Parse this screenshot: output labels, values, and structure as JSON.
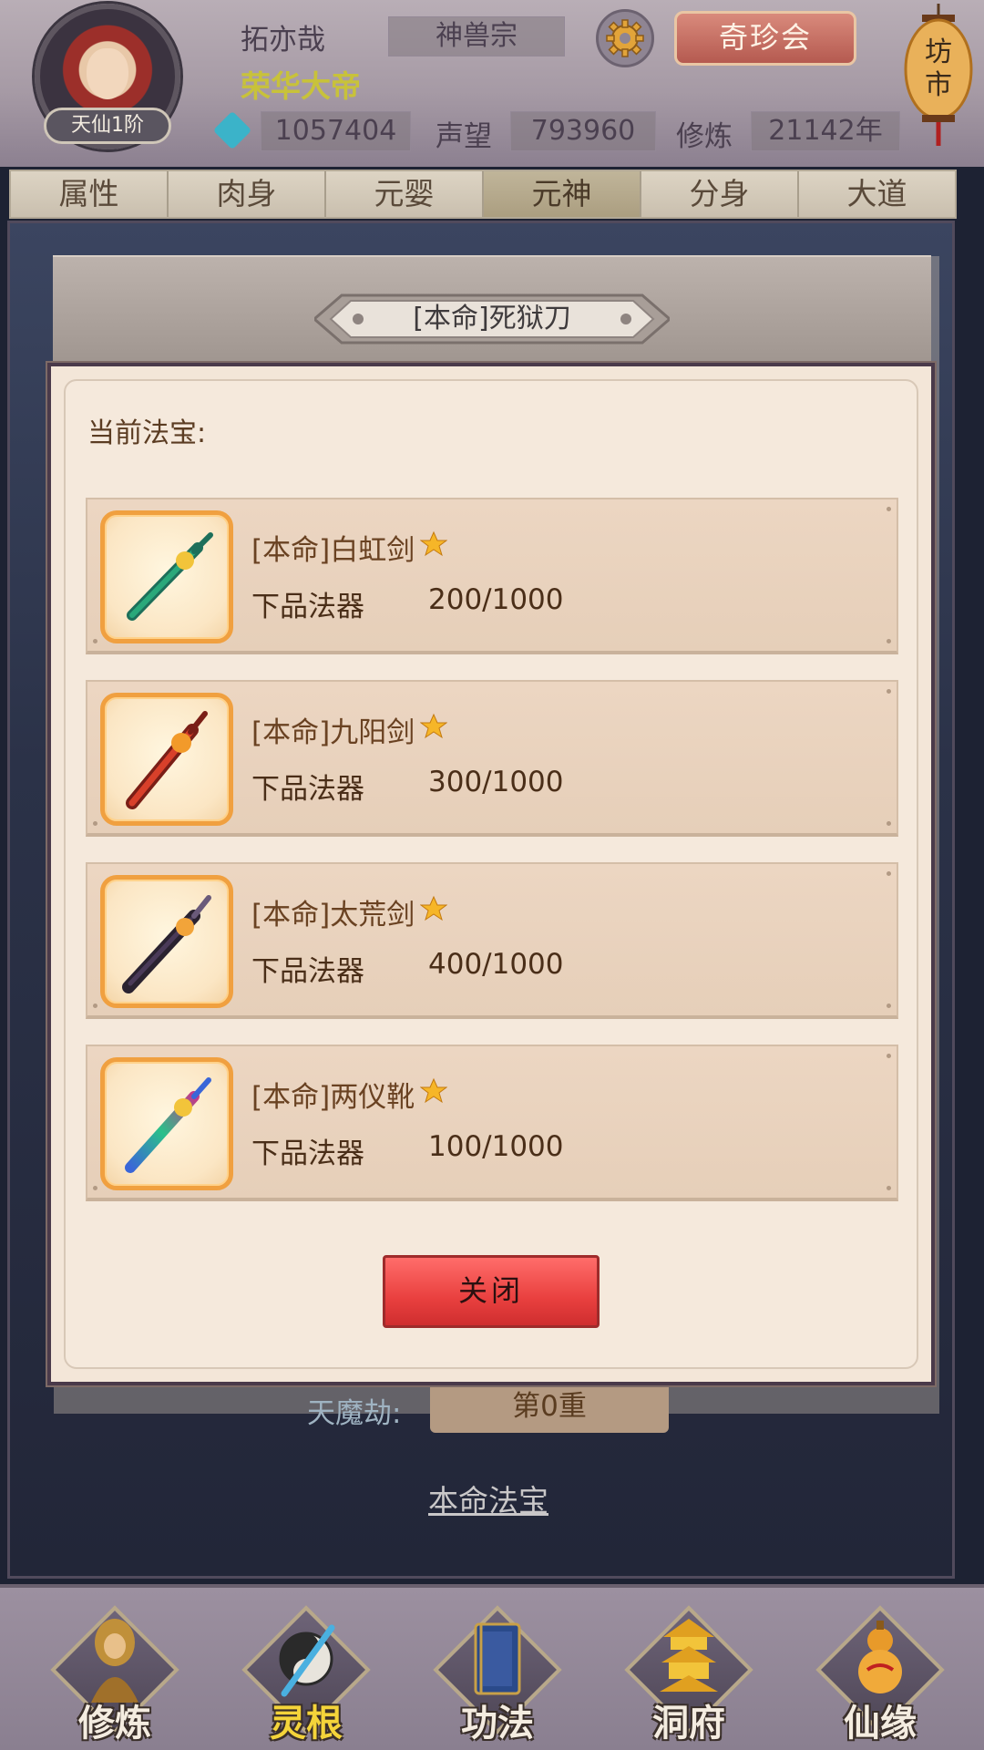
{
  "player": {
    "name": "拓亦哉",
    "title": "荣华大帝",
    "rank": "天仙1阶",
    "sect": "神兽宗",
    "spirit_stones": "1057404",
    "prestige_label": "声望",
    "prestige": "793960",
    "cultivation_label": "修炼",
    "cultivation": "21142年"
  },
  "header": {
    "treasure_button": "奇珍会",
    "market_label": "坊市"
  },
  "tabs": [
    {
      "label": "属性"
    },
    {
      "label": "肉身"
    },
    {
      "label": "元婴"
    },
    {
      "label": "元神"
    },
    {
      "label": "分身"
    },
    {
      "label": "大道"
    }
  ],
  "active_tab": "元神",
  "modal": {
    "title": "[本命]死狱刀",
    "current_label": "当前法宝:",
    "items": [
      {
        "name": "[本命]白虹剑",
        "grade": "下品法器",
        "progress": "200/1000",
        "blade_color": "#2aa87a",
        "hilt_color": "#1d6f5a"
      },
      {
        "name": "[本命]九阳剑",
        "grade": "下品法器",
        "progress": "300/1000",
        "blade_color": "#d8402a",
        "hilt_color": "#7a1e16"
      },
      {
        "name": "[本命]太荒剑",
        "grade": "下品法器",
        "progress": "400/1000",
        "blade_color": "#2a2230",
        "hilt_color": "#6a5a7a"
      },
      {
        "name": "[本命]两仪靴",
        "grade": "下品法器",
        "progress": "100/1000",
        "blade_color": "#3a66d8",
        "hilt_color": "#c23a8a"
      }
    ],
    "close_button": "关闭"
  },
  "background": {
    "tianmojie_label": "天魔劫:",
    "tianmojie_value": "第0重",
    "benming_link": "本命法宝"
  },
  "bottom_nav": [
    {
      "label": "修炼",
      "icon": "monk-icon"
    },
    {
      "label": "灵根",
      "icon": "sword-yinyang-icon",
      "active": true
    },
    {
      "label": "功法",
      "icon": "book-icon"
    },
    {
      "label": "洞府",
      "icon": "pagoda-icon"
    },
    {
      "label": "仙缘",
      "icon": "gourd-icon"
    }
  ],
  "colors": {
    "accent_red": "#e9403f",
    "gold_text": "#c8c23a",
    "frame_orange": "#f0a040"
  }
}
